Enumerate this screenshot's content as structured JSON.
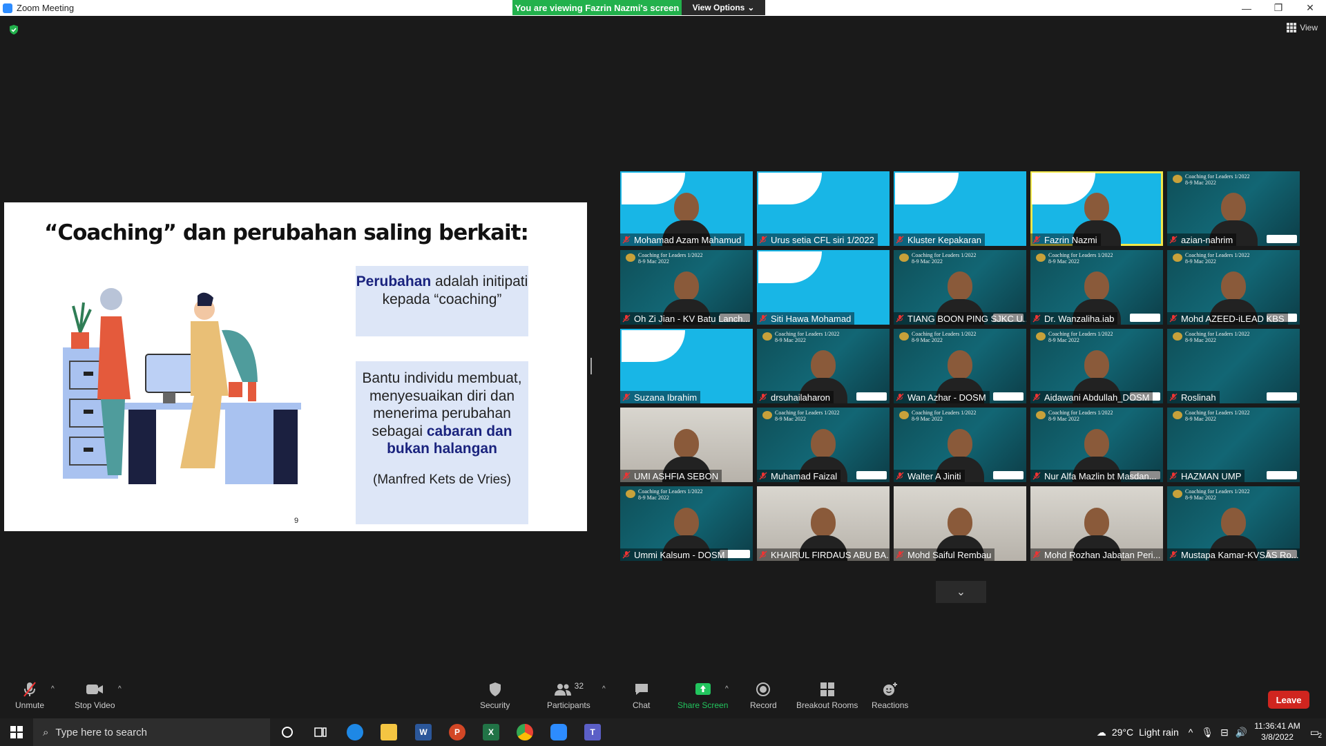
{
  "window": {
    "title": "Zoom Meeting",
    "viewing_banner": "You are viewing Fazrin Nazmi's screen",
    "view_options_label": "View Options",
    "minimize": "—",
    "maximize": "❐",
    "close": "✕"
  },
  "main": {
    "view_label": "View"
  },
  "slide": {
    "title": "“Coaching” dan perubahan saling berkait:",
    "box1_bold": "Perubahan",
    "box1_rest": " adalah initipati kepada “coaching”",
    "box2_text": "Bantu individu membuat, menyesuaikan diri dan menerima perubahan sebagai ",
    "box2_bold": "cabaran dan bukan halangan",
    "box2_quote": "(Manfred Kets de Vries)",
    "page_number": "9"
  },
  "cfl_banner": {
    "line1": "Coaching for Leaders 1/2022",
    "line2": "8-9 Mac 2022"
  },
  "participants": [
    {
      "name": "Mohamad Azam Mahamud",
      "bg": "cyan",
      "person": true
    },
    {
      "name": "Urus setia CFL siri 1/2022",
      "bg": "cyan",
      "person": false
    },
    {
      "name": "Kluster Kepakaran",
      "bg": "cyan",
      "person": false
    },
    {
      "name": "Fazrin Nazmi",
      "bg": "cyan",
      "person": true,
      "active": true
    },
    {
      "name": "azian-nahrim",
      "bg": "teal",
      "person": true
    },
    {
      "name": "Oh Zi Jian - KV Batu Lanch...",
      "bg": "teal",
      "person": true
    },
    {
      "name": "Siti Hawa Mohamad",
      "bg": "cyan",
      "person": false
    },
    {
      "name": "TIANG BOON PING SJKC U...",
      "bg": "teal",
      "person": true
    },
    {
      "name": "Dr. Wanzaliha.iab",
      "bg": "teal",
      "person": true
    },
    {
      "name": "Mohd AZEED-iLEAD KBS",
      "bg": "teal",
      "person": true
    },
    {
      "name": "Suzana Ibrahim",
      "bg": "cyan",
      "person": false
    },
    {
      "name": "drsuhailaharon",
      "bg": "teal",
      "person": true
    },
    {
      "name": "Wan Azhar - DOSM",
      "bg": "teal",
      "person": true
    },
    {
      "name": "Aidawani Abdullah_DOSM",
      "bg": "teal",
      "person": true
    },
    {
      "name": "Roslinah",
      "bg": "teal",
      "person": false
    },
    {
      "name": "UMI ASHFIA SEBON",
      "bg": "room",
      "person": true
    },
    {
      "name": "Muhamad Faizal",
      "bg": "teal",
      "person": true
    },
    {
      "name": "Walter A Jiniti",
      "bg": "teal",
      "person": true
    },
    {
      "name": "Nur Alfa Mazlin bt Masdan...",
      "bg": "teal",
      "person": true
    },
    {
      "name": "HAZMAN UMP",
      "bg": "teal",
      "person": false
    },
    {
      "name": "Ummi Kalsum - DOSM",
      "bg": "teal",
      "person": true
    },
    {
      "name": "KHAIRUL FIRDAUS ABU BA...",
      "bg": "room",
      "person": true
    },
    {
      "name": "Mohd Saiful Rembau",
      "bg": "room",
      "person": true
    },
    {
      "name": "Mohd Rozhan Jabatan Peri...",
      "bg": "room",
      "person": true
    },
    {
      "name": "Mustapa Kamar-KVSAS Ro...",
      "bg": "teal",
      "person": true
    }
  ],
  "toolbar": {
    "unmute": "Unmute",
    "stop_video": "Stop Video",
    "security": "Security",
    "participants": "Participants",
    "participants_count": "32",
    "chat": "Chat",
    "share_screen": "Share Screen",
    "record": "Record",
    "breakout_rooms": "Breakout Rooms",
    "reactions": "Reactions",
    "leave": "Leave"
  },
  "taskbar": {
    "search_placeholder": "Type here to search",
    "temperature": "29°C",
    "weather": "Light rain",
    "time": "11:36:41 AM",
    "date": "3/8/2022",
    "notifications": "2"
  },
  "colors": {
    "zoom_blue": "#2d8cff",
    "banner_green": "#22b14c",
    "leave_red": "#d0251f",
    "active_speaker": "#f2e84a",
    "slide_box": "#dde6f7",
    "slide_highlight": "#1a237e"
  }
}
